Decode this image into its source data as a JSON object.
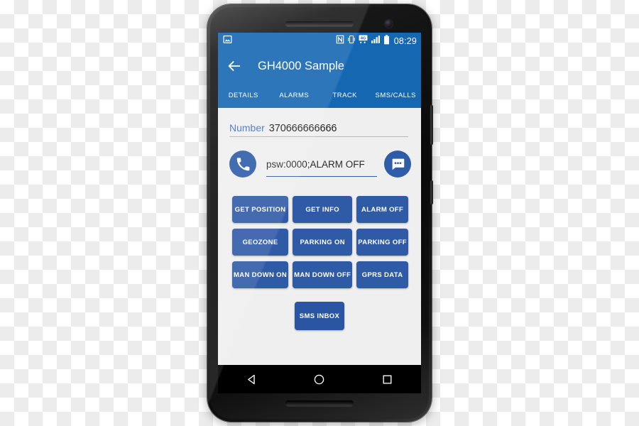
{
  "status_bar": {
    "notification_icon": "image-icon",
    "icons": [
      "nfc-icon",
      "vibrate-icon",
      "4g-data-icon",
      "signal-bars-icon",
      "battery-icon"
    ],
    "time": "08:29"
  },
  "app_bar": {
    "back_icon": "back-arrow-icon",
    "title": "GH4000 Sample"
  },
  "tabs": [
    {
      "label": "DETAILS",
      "selected": true
    },
    {
      "label": "ALARMS",
      "selected": false
    },
    {
      "label": "TRACK",
      "selected": false
    },
    {
      "label": "SMS/CALLS",
      "selected": false
    }
  ],
  "number_field": {
    "label": "Number",
    "value": "370666666666"
  },
  "command_field": {
    "call_icon": "phone-icon",
    "value": "psw:0000;ALARM OFF",
    "send_icon": "sms-bubble-icon"
  },
  "command_buttons": [
    "GET POSITION",
    "GET INFO",
    "ALARM OFF",
    "GEOZONE",
    "PARKING ON",
    "PARKING OFF",
    "MAN DOWN ON",
    "MAN DOWN OFF",
    "GPRS DATA"
  ],
  "inbox_button": {
    "label": "SMS INBOX"
  },
  "nav_bar": {
    "back": "nav-back-triangle-icon",
    "home": "nav-home-circle-icon",
    "recents": "nav-recents-square-icon"
  },
  "colors": {
    "toolbar_blue": "#1667b2",
    "button_blue": "#2f5aa6",
    "label_blue": "#3f72c4",
    "screen_bg": "#efefef",
    "nav_bg": "#000000"
  }
}
